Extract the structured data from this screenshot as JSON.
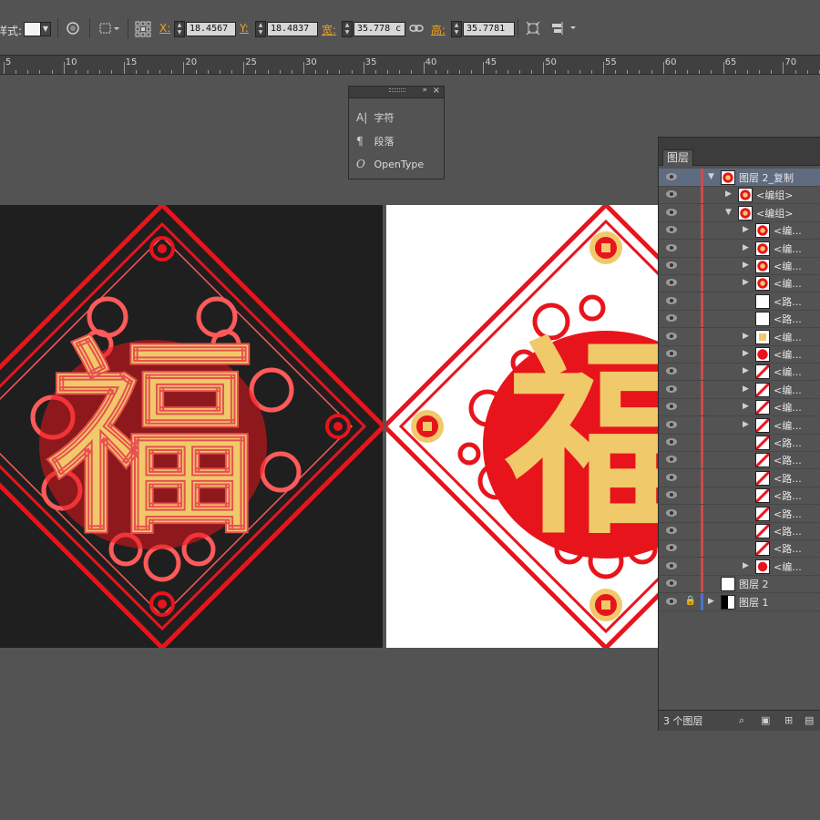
{
  "control_bar": {
    "style_label": "样式:",
    "x_label": "X:",
    "x_value": "18.4567",
    "y_label": "Y:",
    "y_value": "18.4837",
    "w_label": "宽:",
    "w_value": "35.778 c",
    "h_label": "高:",
    "h_value": "35.7781",
    "icons": [
      "stroke-swatch-icon",
      "recolor-icon",
      "reference-point-icon",
      "constrain-link-icon",
      "transform-icon",
      "align-icon"
    ]
  },
  "ruler": {
    "numbers": [
      "5",
      "10",
      "15",
      "20",
      "25",
      "30",
      "35",
      "40",
      "45",
      "50",
      "55",
      "60",
      "65",
      "70"
    ]
  },
  "type_panel": {
    "items": [
      {
        "icon": "character-icon",
        "glyph": "A|",
        "label": "字符"
      },
      {
        "icon": "paragraph-icon",
        "glyph": "¶",
        "label": "段落"
      },
      {
        "icon": "opentype-icon",
        "glyph": "O",
        "label": "OpenType"
      }
    ]
  },
  "artwork": {
    "character": "福"
  },
  "layers_panel": {
    "tab_label": "图层",
    "rows": [
      {
        "name": "图层 2_复制",
        "expanded": true,
        "selected": true
      },
      {
        "name": "<编组>",
        "expanded": false
      },
      {
        "name": "<编组>",
        "expanded": true
      },
      {
        "name": "<编..."
      },
      {
        "name": "<编..."
      },
      {
        "name": "<编..."
      },
      {
        "name": "<编..."
      },
      {
        "name": "<路..."
      },
      {
        "name": "<路..."
      },
      {
        "name": "<编..."
      },
      {
        "name": "<编..."
      },
      {
        "name": "<编..."
      },
      {
        "name": "<编..."
      },
      {
        "name": "<编..."
      },
      {
        "name": "<编..."
      },
      {
        "name": "<路..."
      },
      {
        "name": "<路..."
      },
      {
        "name": "<路..."
      },
      {
        "name": "<路..."
      },
      {
        "name": "<路..."
      },
      {
        "name": "<路..."
      },
      {
        "name": "<路..."
      },
      {
        "name": "<编..."
      },
      {
        "name": "图层 2"
      },
      {
        "name": "图层 1",
        "locked": true
      }
    ],
    "footer": {
      "count_label": "3 个图层",
      "icons": [
        "locate-object-icon",
        "make-clipping-mask-icon",
        "new-sublayer-icon",
        "new-layer-icon",
        "delete-layer-icon"
      ]
    }
  },
  "colors": {
    "red": "#e8141c",
    "gold": "#f0c96a",
    "selection_red": "#ff5a5a",
    "layer_color_red": "#d04a4a",
    "layer_color_blue": "#4a72d0"
  }
}
